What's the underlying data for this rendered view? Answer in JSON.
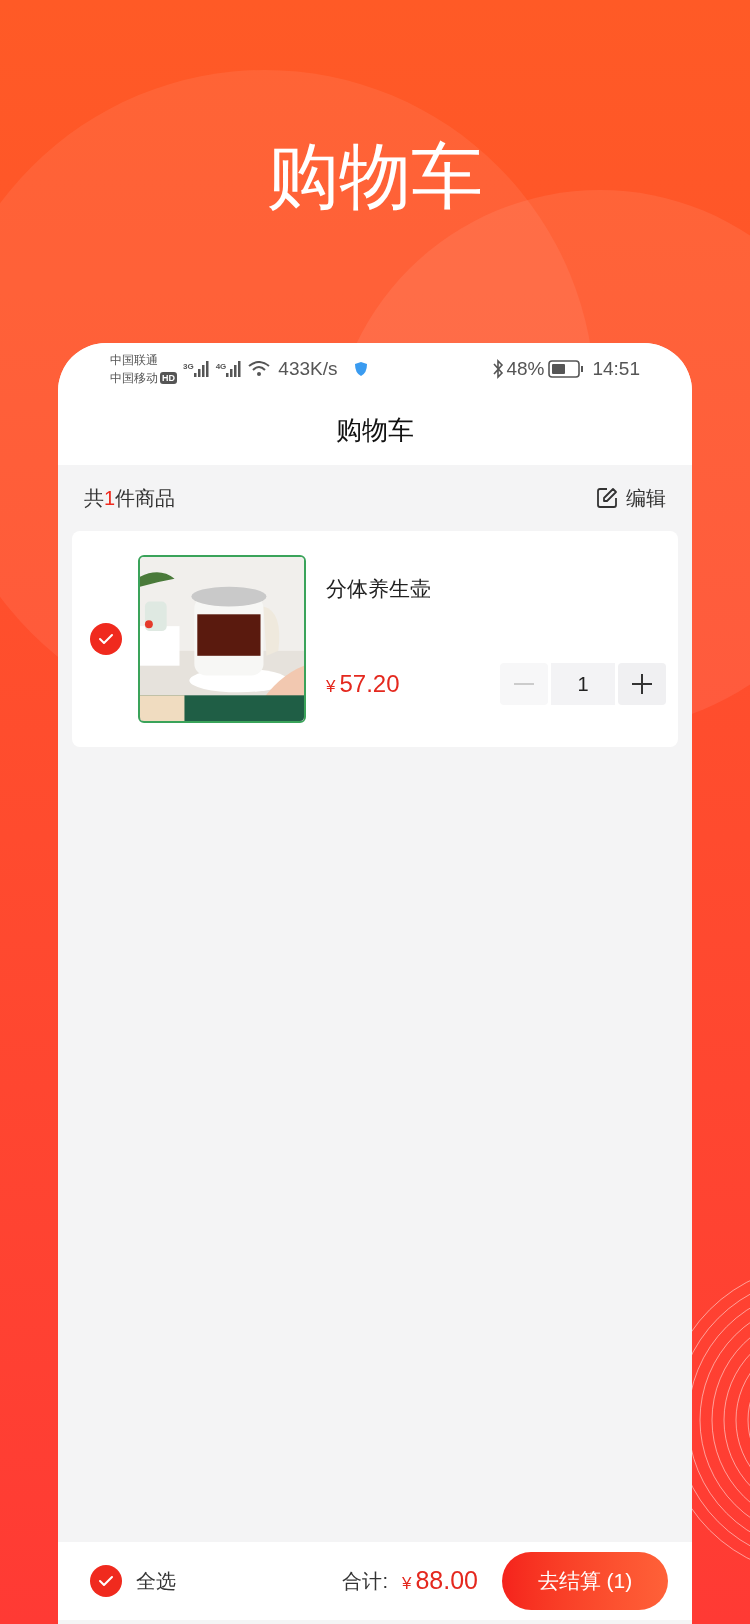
{
  "headline": "购物车",
  "status_bar": {
    "carriers": [
      "中国联通",
      "中国移动"
    ],
    "hd_badge": "HD",
    "networks": [
      "3G",
      "4G"
    ],
    "speed": "433K/s",
    "battery": "48%",
    "time": "14:51"
  },
  "nav_title": "购物车",
  "summary": {
    "prefix": "共",
    "count": "1",
    "suffix": "件商品",
    "edit": "编辑"
  },
  "items": [
    {
      "name": "分体养生壶",
      "currency": "¥",
      "price": "57.20",
      "quantity": "1",
      "checked": true,
      "minus_disabled": true
    }
  ],
  "footer": {
    "select_all": {
      "label": "全选",
      "checked": true
    },
    "total_label": "合计:",
    "currency": "¥",
    "total": "88.00",
    "checkout": "去结算 (1)"
  }
}
